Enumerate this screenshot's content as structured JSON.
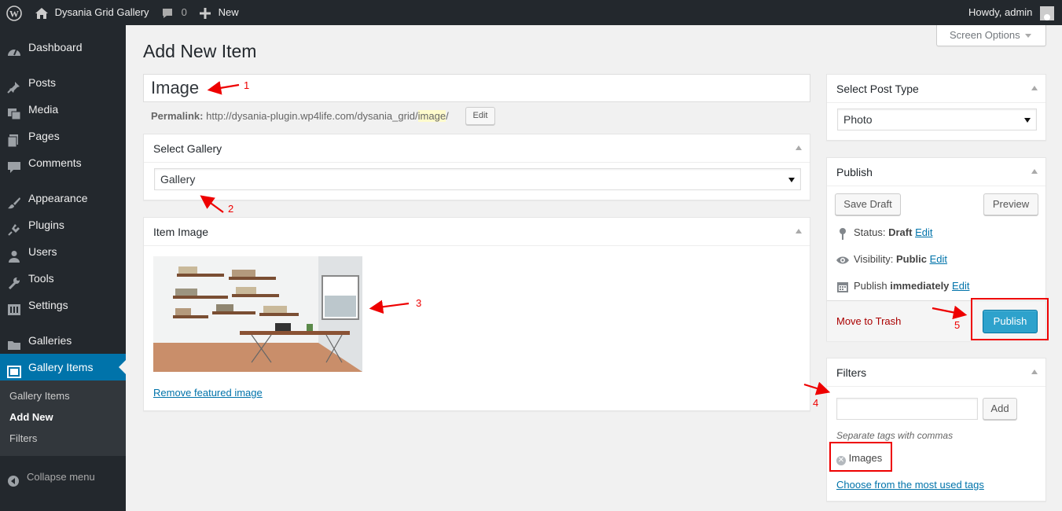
{
  "admin_bar": {
    "site_name": "Dysania Grid Gallery",
    "comments_count": "0",
    "new_label": "New",
    "greeting": "Howdy, admin"
  },
  "sidebar": {
    "items": [
      {
        "label": "Dashboard",
        "icon": "dashboard-icon"
      },
      {
        "label": "Posts",
        "icon": "pin-icon"
      },
      {
        "label": "Media",
        "icon": "media-icon"
      },
      {
        "label": "Pages",
        "icon": "pages-icon"
      },
      {
        "label": "Comments",
        "icon": "comment-icon"
      },
      {
        "label": "Appearance",
        "icon": "brush-icon"
      },
      {
        "label": "Plugins",
        "icon": "plugin-icon"
      },
      {
        "label": "Users",
        "icon": "user-icon"
      },
      {
        "label": "Tools",
        "icon": "wrench-icon"
      },
      {
        "label": "Settings",
        "icon": "settings-icon"
      },
      {
        "label": "Galleries",
        "icon": "folder-icon"
      },
      {
        "label": "Gallery Items",
        "icon": "gallery-icon"
      }
    ],
    "submenu": [
      "Gallery Items",
      "Add New",
      "Filters"
    ],
    "collapse_label": "Collapse menu"
  },
  "screen_options": "Screen Options",
  "page_title": "Add New Item",
  "title_field": {
    "value": "Image"
  },
  "permalink": {
    "label": "Permalink:",
    "url_base": "http://dysania-plugin.wp4life.com/dysania_grid/",
    "slug": "image",
    "suffix": "/",
    "edit_label": "Edit"
  },
  "select_gallery": {
    "title": "Select Gallery",
    "selected": "Gallery"
  },
  "item_image": {
    "title": "Item Image",
    "remove_label": "Remove featured image"
  },
  "post_type": {
    "title": "Select Post Type",
    "selected": "Photo"
  },
  "publish": {
    "title": "Publish",
    "save_draft": "Save Draft",
    "preview": "Preview",
    "status_label": "Status:",
    "status_value": "Draft",
    "visibility_label": "Visibility:",
    "visibility_value": "Public",
    "schedule_label": "Publish",
    "schedule_value": "immediately",
    "edit_label": "Edit",
    "trash_label": "Move to Trash",
    "publish_label": "Publish"
  },
  "filters": {
    "title": "Filters",
    "input_value": "",
    "add_label": "Add",
    "hint": "Separate tags with commas",
    "tags": [
      "Images"
    ],
    "most_used_label": "Choose from the most used tags"
  },
  "annotations": [
    "1",
    "2",
    "3",
    "4",
    "5"
  ],
  "colors": {
    "admin_bar": "#23282d",
    "sidebar": "#23282d",
    "accent": "#0073aa",
    "publish_button": "#2ea2cc",
    "annotation": "#e00000"
  }
}
